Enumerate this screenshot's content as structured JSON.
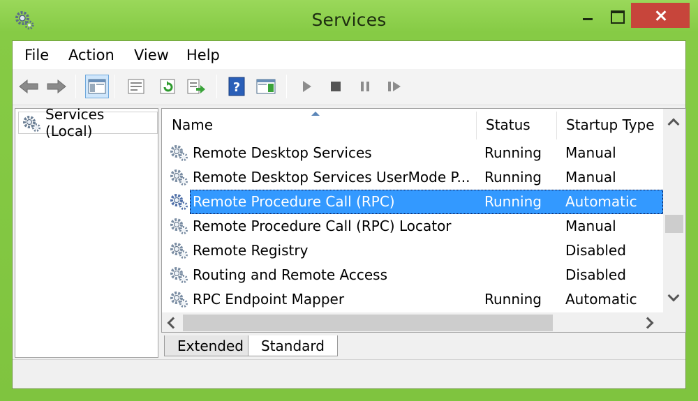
{
  "window": {
    "title": "Services",
    "icon": "services-gear-icon"
  },
  "menu": [
    "File",
    "Action",
    "View",
    "Help"
  ],
  "toolbar": {
    "buttons": [
      "back-icon",
      "forward-icon",
      "show-hide-console-tree-icon",
      "properties-icon",
      "refresh-icon",
      "export-list-icon",
      "help-icon",
      "show-hide-action-pane-icon",
      "start-service-icon",
      "stop-service-icon",
      "pause-service-icon",
      "resume-service-icon"
    ]
  },
  "tree": {
    "root_label": "Services (Local)"
  },
  "list": {
    "columns": [
      "Name",
      "Status",
      "Startup Type"
    ],
    "rows": [
      {
        "name": "Remote Desktop Services",
        "status": "Running",
        "startup": "Manual"
      },
      {
        "name": "Remote Desktop Services UserMode P...",
        "status": "Running",
        "startup": "Manual"
      },
      {
        "name": "Remote Procedure Call (RPC)",
        "status": "Running",
        "startup": "Automatic",
        "selected": true
      },
      {
        "name": "Remote Procedure Call (RPC) Locator",
        "status": "",
        "startup": "Manual"
      },
      {
        "name": "Remote Registry",
        "status": "",
        "startup": "Disabled"
      },
      {
        "name": "Routing and Remote Access",
        "status": "",
        "startup": "Disabled"
      },
      {
        "name": "RPC Endpoint Mapper",
        "status": "Running",
        "startup": "Automatic"
      }
    ]
  },
  "tabs": [
    "Extended",
    "Standard"
  ],
  "active_tab": "Standard",
  "colors": {
    "frame": "#7fc43f",
    "selection": "#3399ff",
    "close_button": "#c7453b"
  }
}
